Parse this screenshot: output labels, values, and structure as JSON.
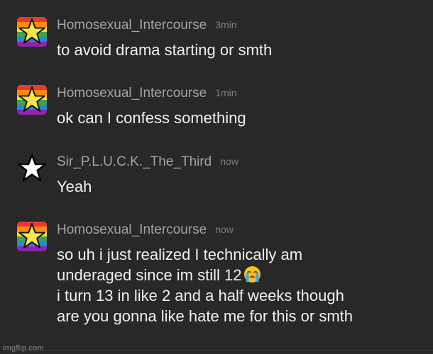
{
  "messages": [
    {
      "username": "Homosexual_Intercourse",
      "time": "3min",
      "avatar": "rainbow-star-icon",
      "lines": [
        "to avoid drama starting or smth"
      ]
    },
    {
      "username": "Homosexual_Intercourse",
      "time": "1min",
      "avatar": "rainbow-star-icon",
      "lines": [
        "ok can I confess something"
      ]
    },
    {
      "username": "Sir_P.L.U.C.K._The_Third",
      "time": "now",
      "avatar": "white-star-icon",
      "lines": [
        "Yeah"
      ]
    },
    {
      "username": "Homosexual_Intercourse",
      "time": "now",
      "avatar": "rainbow-star-icon",
      "lines": [
        "so uh i just realized I technically am",
        "underaged since im still 12",
        "i turn 13 in like 2 and a half weeks though",
        "are you gonna like hate me for this or smth"
      ],
      "emoji": "loudly-crying-face"
    }
  ],
  "watermark": "imgflip.com",
  "colors": {
    "background": "#282828",
    "username": "#a3a3a3",
    "timestamp": "#7e7e7e",
    "message_text": "#f0f0f0"
  }
}
